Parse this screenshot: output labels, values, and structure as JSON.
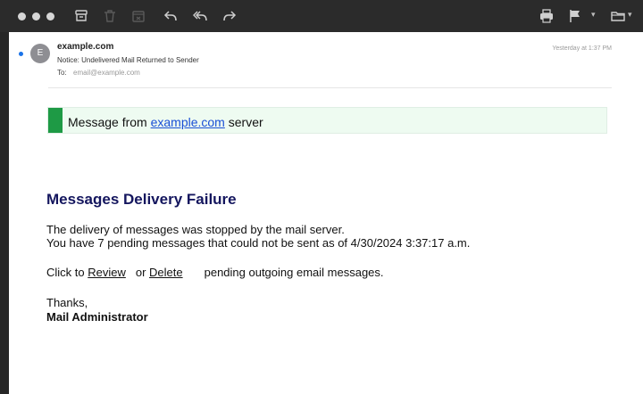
{
  "message": {
    "sender": "example.com",
    "avatar_initial": "E",
    "subject": "Notice: Undelivered Mail Returned to Sender",
    "to_label": "To:",
    "to_address": "email@example.com",
    "date": "Yesterday at 1:37 PM"
  },
  "banner": {
    "prefix": "Message from ",
    "link": "example.com",
    "suffix": " server"
  },
  "body": {
    "heading": "Messages Delivery Failure",
    "line1": "The delivery of messages was stopped by the mail server.",
    "line2": "You have 7 pending messages that could not be sent as of 4/30/2024 3:37:17 a.m.",
    "click_to": "Click to ",
    "review": "Review",
    "or": "or ",
    "delete": "Delete",
    "pending": "pending outgoing email messages.",
    "thanks": "Thanks,",
    "signature": "Mail Administrator"
  },
  "toolbar": {
    "icons": [
      "window-controls",
      "archive-icon",
      "trash-icon",
      "junk-icon",
      "reply-icon",
      "reply-all-icon",
      "forward-icon",
      "print-icon",
      "flag-icon",
      "folder-icon"
    ]
  }
}
